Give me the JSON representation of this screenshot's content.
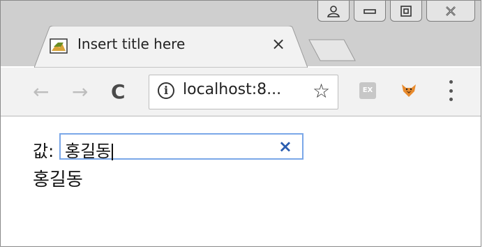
{
  "browser": {
    "tab": {
      "title": "Insert title here",
      "favicon": "page-favicon-icon",
      "close": "×"
    },
    "window_controls": {
      "user": "user-icon",
      "minimize": "minimize-icon",
      "restore": "restore-icon",
      "close": "close-icon"
    },
    "toolbar": {
      "back": "←",
      "forward": "→",
      "reload": "C",
      "url": "localhost:8...",
      "info": "i",
      "star": "☆",
      "extension_label": "EX",
      "menu": "more-vert-icon"
    }
  },
  "page": {
    "label": "값:",
    "input_value": "홍길동",
    "clear": "×",
    "output": "홍길동"
  },
  "colors": {
    "input_border": "#7aa7e8",
    "clear_icon": "#2a5db0",
    "titlebar": "#cfcfcf",
    "toolbar": "#f2f2f2"
  }
}
